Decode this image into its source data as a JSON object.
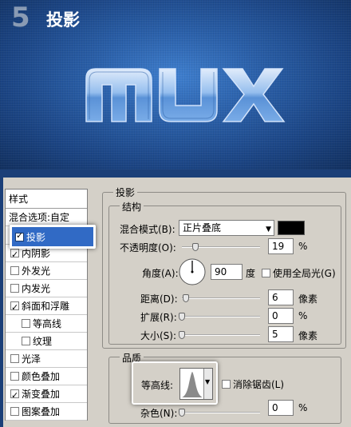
{
  "banner": {
    "step_number": "5",
    "step_title": "投影",
    "logo_text": "MUX"
  },
  "style_list": {
    "header": "样式",
    "blend_options": "混合选项:自定",
    "items": [
      {
        "label": "投影",
        "checked": true,
        "selected": true
      },
      {
        "label": "内阴影",
        "checked": true
      },
      {
        "label": "外发光",
        "checked": false
      },
      {
        "label": "内发光",
        "checked": false
      },
      {
        "label": "斜面和浮雕",
        "checked": true
      },
      {
        "label": "等高线",
        "checked": false
      },
      {
        "label": "纹理",
        "checked": false
      },
      {
        "label": "光泽",
        "checked": false
      },
      {
        "label": "颜色叠加",
        "checked": false
      },
      {
        "label": "渐变叠加",
        "checked": true
      },
      {
        "label": "图案叠加",
        "checked": false
      }
    ]
  },
  "shadow_panel": {
    "title": "投影",
    "structure_title": "结构",
    "blend_mode_label": "混合模式(B):",
    "blend_mode_value": "正片叠底",
    "blend_color": "#000000",
    "opacity_label": "不透明度(O):",
    "opacity_value": "19",
    "opacity_unit": "%",
    "angle_label": "角度(A):",
    "angle_value": "90",
    "angle_unit": "度",
    "global_light_label": "使用全局光(G)",
    "distance_label": "距离(D):",
    "distance_value": "6",
    "distance_unit": "像素",
    "spread_label": "扩展(R):",
    "spread_value": "0",
    "spread_unit": "%",
    "size_label": "大小(S):",
    "size_value": "5",
    "size_unit": "像素",
    "quality_title": "品质",
    "contour_label": "等高线:",
    "anti_alias_label": "消除锯齿(L)",
    "noise_label": "杂色(N):",
    "noise_value": "0",
    "noise_unit": "%"
  }
}
